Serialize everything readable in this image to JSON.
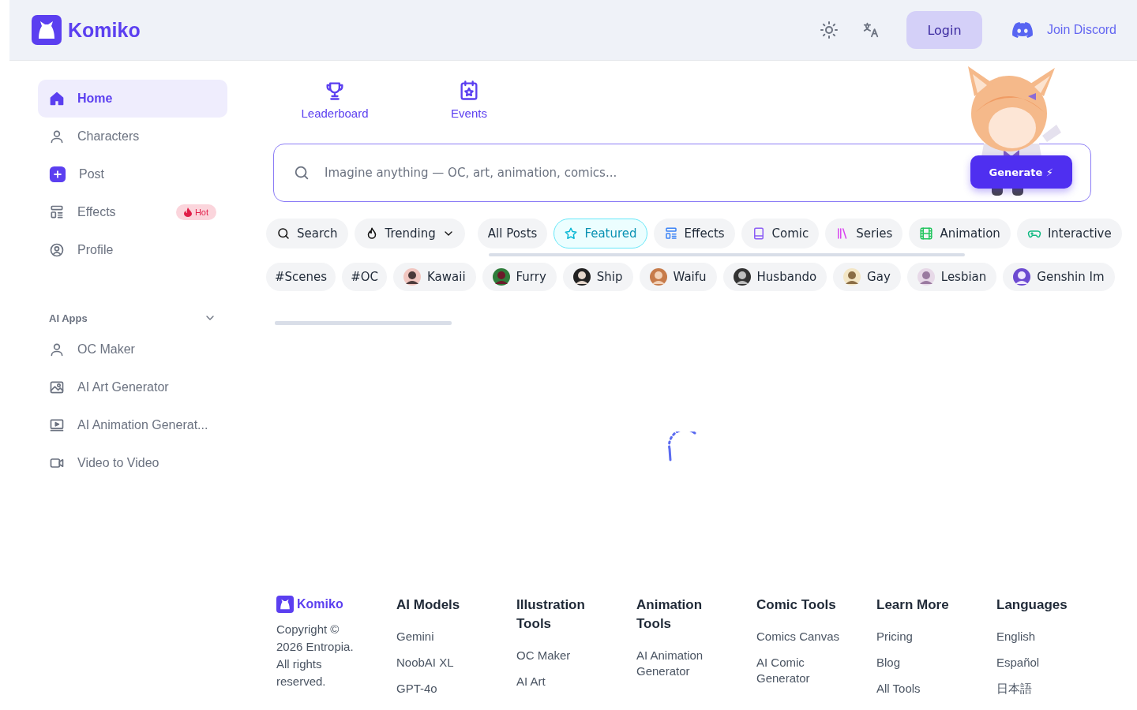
{
  "header": {
    "logo_text": "Komiko",
    "login": "Login",
    "discord": "Join Discord"
  },
  "sidebar": {
    "items": [
      {
        "label": "Home",
        "selected": true
      },
      {
        "label": "Characters",
        "selected": false
      },
      {
        "label": "Post",
        "selected": false
      },
      {
        "label": "Effects",
        "selected": false,
        "badge": "Hot"
      },
      {
        "label": "Profile",
        "selected": false
      }
    ],
    "section": {
      "title": "AI Apps",
      "expanded": true,
      "items": [
        {
          "label": "OC Maker"
        },
        {
          "label": "AI Art Generator"
        },
        {
          "label": "AI Animation Generat..."
        },
        {
          "label": "Video to Video"
        }
      ]
    }
  },
  "quick_links": [
    {
      "label": "Leaderboard"
    },
    {
      "label": "Events"
    }
  ],
  "prompt": {
    "placeholder": "Imagine anything — OC, art, animation, comics...",
    "button": "Generate ⚡"
  },
  "filters": {
    "search": "Search",
    "sort": "Trending"
  },
  "categories": [
    {
      "label": "All Posts",
      "selected": false
    },
    {
      "label": "Featured",
      "selected": true
    },
    {
      "label": "Effects",
      "selected": false
    },
    {
      "label": "Comic",
      "selected": false
    },
    {
      "label": "Series",
      "selected": false
    },
    {
      "label": "Animation",
      "selected": false
    },
    {
      "label": "Interactive",
      "selected": false
    }
  ],
  "tags": [
    {
      "label": "#Scenes",
      "kind": "text"
    },
    {
      "label": "#OC",
      "kind": "text"
    },
    {
      "label": "Kawaii",
      "kind": "avatar"
    },
    {
      "label": "Furry",
      "kind": "avatar"
    },
    {
      "label": "Ship",
      "kind": "avatar"
    },
    {
      "label": "Waifu",
      "kind": "avatar"
    },
    {
      "label": "Husbando",
      "kind": "avatar"
    },
    {
      "label": "Gay",
      "kind": "avatar"
    },
    {
      "label": "Lesbian",
      "kind": "avatar"
    },
    {
      "label": "Genshin Im",
      "kind": "avatar"
    }
  ],
  "footer": {
    "logo_text": "Komiko",
    "copyright": "Copyright © 2026 Entropia. All rights reserved.",
    "columns": [
      {
        "title": "AI Models",
        "links": [
          "Gemini",
          "NoobAI XL",
          "GPT-4o"
        ]
      },
      {
        "title": "Illustration Tools",
        "links": [
          "OC Maker",
          "AI Art"
        ]
      },
      {
        "title": "Animation Tools",
        "links": [
          "AI Animation Generator"
        ]
      },
      {
        "title": "Comic Tools",
        "links": [
          "Comics Canvas",
          "AI Comic Generator"
        ]
      },
      {
        "title": "Learn More",
        "links": [
          "Pricing",
          "Blog",
          "All Tools"
        ]
      },
      {
        "title": "Languages",
        "links": [
          "English",
          "Español",
          "日本語"
        ]
      }
    ]
  }
}
